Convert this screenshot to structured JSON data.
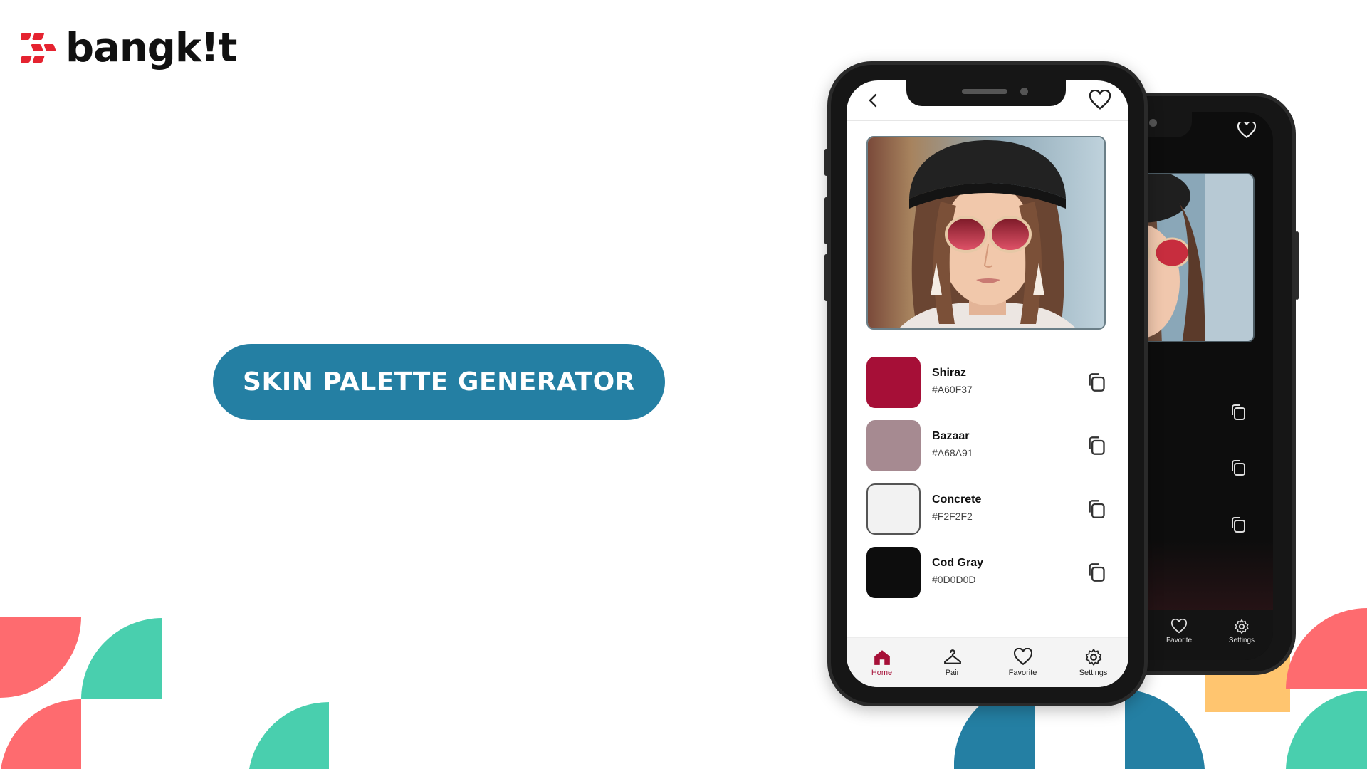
{
  "brand": {
    "name": "bangkit",
    "wordmark": "bangk!t"
  },
  "title": "SKIN PALETTE GENERATOR",
  "colors": {
    "pill": "#247fa3",
    "coral": "#fe6b6f",
    "teal": "#49cfae",
    "blue": "#247fa3",
    "yellow": "#ffc56f",
    "logo_red": "#e52330"
  },
  "app": {
    "back_icon": "chevron-left-icon",
    "favorite_icon": "heart-icon",
    "palette": [
      {
        "name": "Shiraz",
        "hex": "#A60F37",
        "color": "#a60f37"
      },
      {
        "name": "Bazaar",
        "hex": "#A68A91",
        "color": "#a68a91"
      },
      {
        "name": "Concrete",
        "hex": "#F2F2F2",
        "color": "#f2f2f2"
      },
      {
        "name": "Cod Gray",
        "hex": "#0D0D0D",
        "color": "#0d0d0d"
      }
    ],
    "nav": [
      {
        "label": "Home",
        "icon": "home-icon",
        "active": true
      },
      {
        "label": "Pair",
        "icon": "hanger-icon",
        "active": false
      },
      {
        "label": "Favorite",
        "icon": "heart-icon",
        "active": false
      },
      {
        "label": "Settings",
        "icon": "gear-icon",
        "active": false
      }
    ],
    "back_phone_nav": [
      {
        "label": "Favorite",
        "icon": "heart-icon"
      },
      {
        "label": "Settings",
        "icon": "gear-icon"
      }
    ]
  }
}
